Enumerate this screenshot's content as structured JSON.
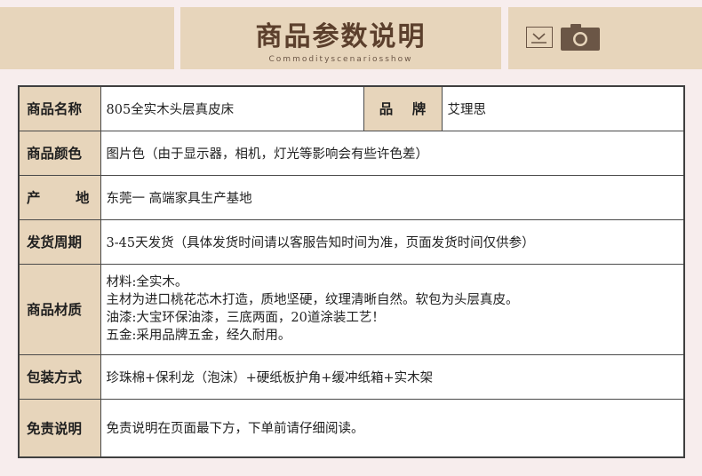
{
  "header": {
    "title": "商品参数说明",
    "subtitle": "Commodityscenariosshow",
    "icons": [
      "download-box-icon",
      "camera-icon"
    ]
  },
  "colors": {
    "header_bg": "#e7d5bb",
    "label_bg": "#e7d5bb",
    "page_bg": "#f7eded",
    "title_text": "#5b3f2c"
  },
  "specs": {
    "name": {
      "label": "商品名称",
      "value": "805全实木头层真皮床"
    },
    "brand": {
      "label_char_1": "品",
      "label_char_2": "牌",
      "value": "艾理思"
    },
    "color": {
      "label": "商品颜色",
      "value": "图片色（由于显示器，相机，灯光等影响会有些许色差）"
    },
    "origin": {
      "label_char_1": "产",
      "label_char_2": "地",
      "value": "东莞一 高端家具生产基地"
    },
    "shipping": {
      "label": "发货周期",
      "value": "3-45天发货（具体发货时间请以客服告知时间为准，页面发货时间仅供参）"
    },
    "material": {
      "label": "商品材质",
      "lines": [
        "材料:全实木。",
        "主材为进口桃花芯木打造，质地坚硬，纹理清晰自然。软包为头层真皮。",
        "油漆:大宝环保油漆，三底两面，20道涂装工艺！",
        "五金:采用品牌五金，经久耐用。"
      ]
    },
    "packaging": {
      "label": "包装方式",
      "value": "珍珠棉+保利龙（泡沫）+硬纸板护角+缓冲纸箱+实木架"
    },
    "disclaimer": {
      "label": "免责说明",
      "value": "免责说明在页面最下方，下单前请仔细阅读。"
    }
  }
}
